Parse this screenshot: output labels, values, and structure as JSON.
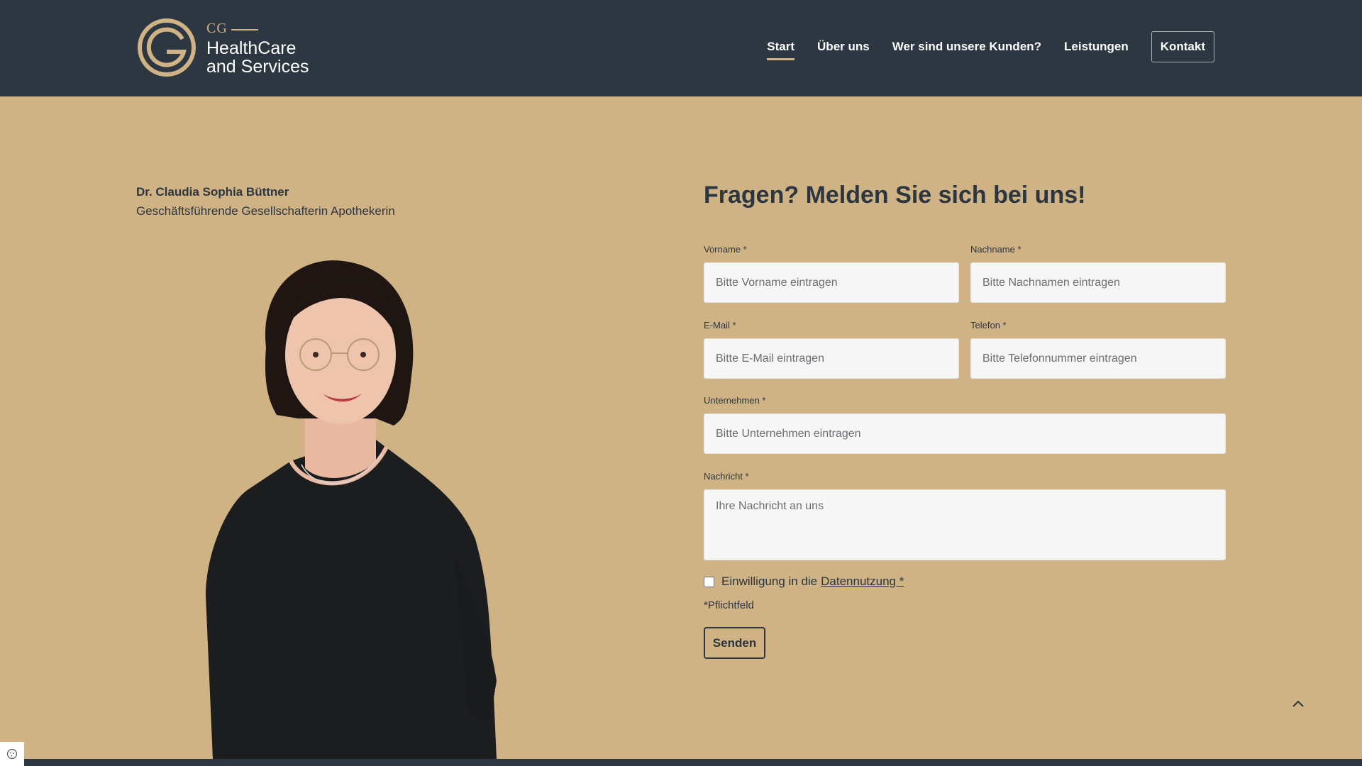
{
  "brand": {
    "cg": "CG",
    "line1": "HealthCare",
    "line2": "and Services",
    "gold": "#cfb384",
    "navy": "#2d3742"
  },
  "nav": {
    "items": [
      {
        "label": "Start",
        "active": true
      },
      {
        "label": "Über uns"
      },
      {
        "label": "Wer sind unsere Kunden?"
      },
      {
        "label": "Leistungen"
      }
    ],
    "contact_label": "Kontakt"
  },
  "person": {
    "name": "Dr. Claudia Sophia Büttner",
    "role": "Geschäftsführende Gesellschafterin Apothekerin"
  },
  "form": {
    "title": "Fragen? Melden Sie sich bei uns!",
    "fields": {
      "firstname": {
        "label": "Vorname *",
        "placeholder": "Bitte Vorname eintragen"
      },
      "lastname": {
        "label": "Nachname *",
        "placeholder": "Bitte Nachnamen eintragen"
      },
      "email": {
        "label": "E-Mail *",
        "placeholder": "Bitte E-Mail eintragen"
      },
      "phone": {
        "label": "Telefon *",
        "placeholder": "Bitte Telefonnummer eintragen"
      },
      "company": {
        "label": "Unternehmen *",
        "placeholder": "Bitte Unternehmen eintragen"
      },
      "message": {
        "label": "Nachricht *",
        "placeholder": "Ihre Nachricht an uns"
      }
    },
    "consent_text": "Einwilligung in die",
    "consent_link": "Datennutzung *",
    "required_note": "*Pflichtfeld",
    "submit_label": "Senden"
  },
  "icons": {
    "scroll_top": "chevron-up-icon",
    "cookie": "cookie-icon"
  }
}
